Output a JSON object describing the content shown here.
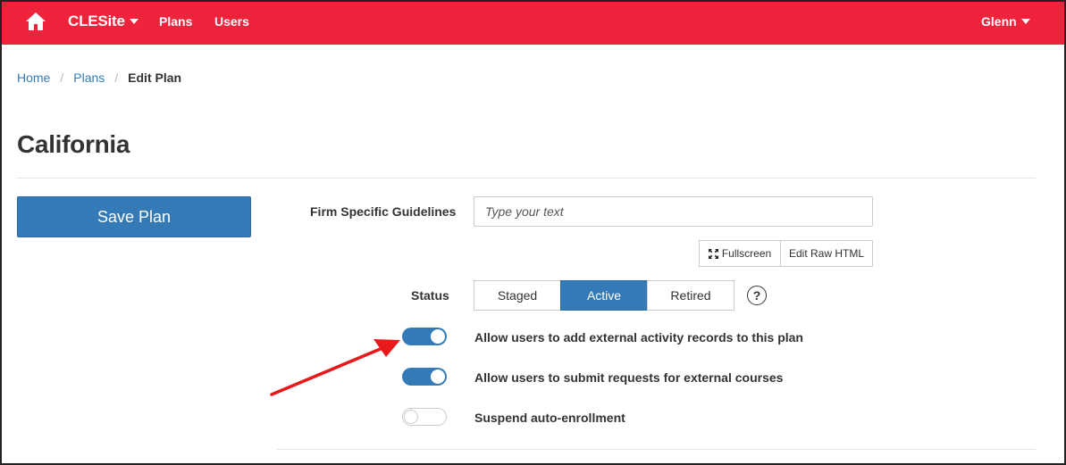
{
  "navbar": {
    "brand": "CLESite",
    "links": [
      "Plans",
      "Users"
    ],
    "user": "Glenn",
    "home_icon": "home-icon",
    "background": "#ef233c"
  },
  "breadcrumb": {
    "items": [
      "Home",
      "Plans"
    ],
    "separator": "/",
    "active": "Edit Plan"
  },
  "page": {
    "title": "California"
  },
  "actions": {
    "save_label": "Save Plan"
  },
  "form": {
    "guidelines": {
      "label": "Firm Specific Guidelines",
      "placeholder": "Type your text",
      "value": ""
    },
    "editor_buttons": {
      "fullscreen": "Fullscreen",
      "raw_html": "Edit Raw HTML"
    },
    "status": {
      "label": "Status",
      "options": [
        "Staged",
        "Active",
        "Retired"
      ],
      "selected": "Active",
      "help": "?"
    },
    "toggles": [
      {
        "label": "Allow users to add external activity records to this plan",
        "on": true
      },
      {
        "label": "Allow users to submit requests for external courses",
        "on": true
      },
      {
        "label": "Suspend auto-enrollment",
        "on": false
      }
    ]
  },
  "colors": {
    "primary": "#337ab7",
    "annotation_arrow": "#e8191b"
  }
}
